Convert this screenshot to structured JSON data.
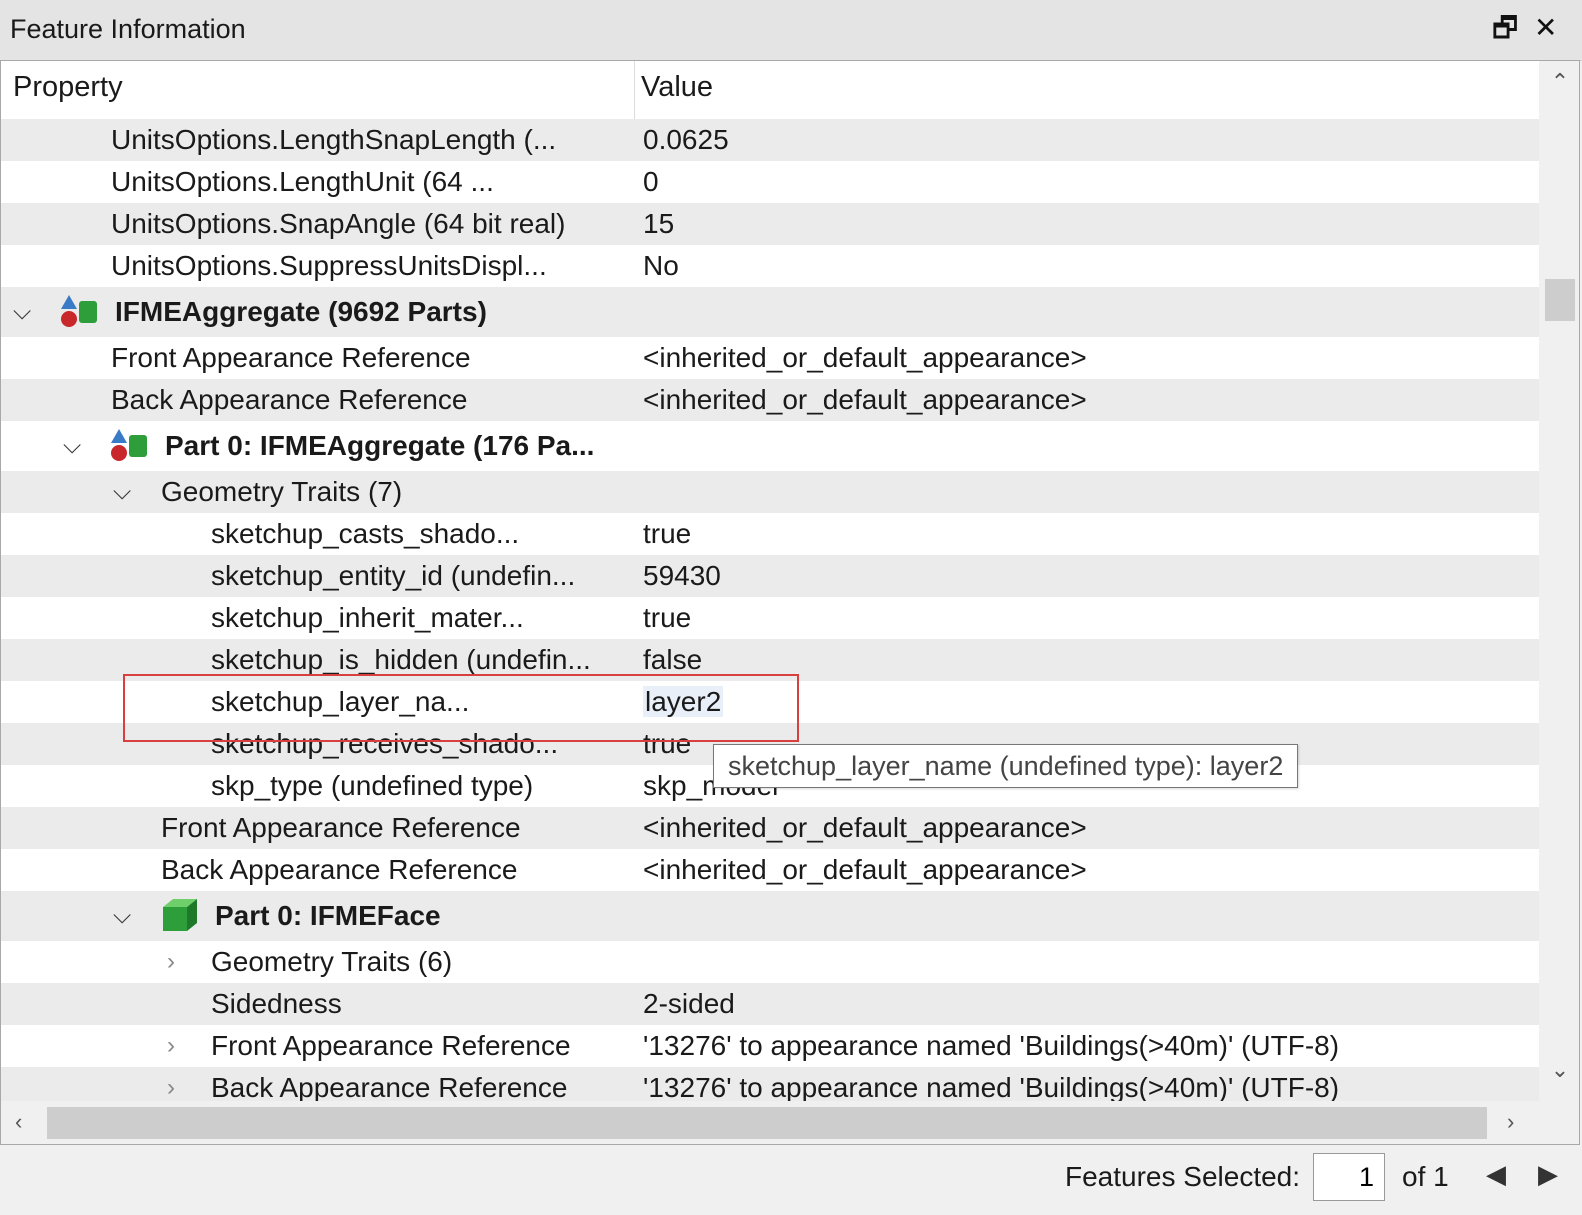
{
  "window": {
    "title": "Feature Information",
    "restore_icon": "restore-window-icon",
    "close_icon": "close-icon"
  },
  "table": {
    "columns": {
      "property": "Property",
      "value": "Value"
    },
    "rows": [
      {
        "prop": "UnitsOptions.LengthSnapLength (...",
        "val": "0.0625"
      },
      {
        "prop": "UnitsOptions.LengthUnit (64 ...",
        "val": "0"
      },
      {
        "prop": "UnitsOptions.SnapAngle (64 bit real)",
        "val": "15"
      },
      {
        "prop": "UnitsOptions.SuppressUnitsDispl...",
        "val": "No"
      },
      {
        "prop": "IFMEAggregate (9692 Parts)",
        "val": ""
      },
      {
        "prop": "Front Appearance Reference",
        "val": "<inherited_or_default_appearance>"
      },
      {
        "prop": "Back Appearance Reference",
        "val": "<inherited_or_default_appearance>"
      },
      {
        "prop": "Part 0: IFMEAggregate (176 Pa...",
        "val": ""
      },
      {
        "prop": "Geometry Traits (7)",
        "val": ""
      },
      {
        "prop": "sketchup_casts_shado...",
        "val": "true"
      },
      {
        "prop": "sketchup_entity_id (undefin...",
        "val": "59430"
      },
      {
        "prop": "sketchup_inherit_mater...",
        "val": "true"
      },
      {
        "prop": "sketchup_is_hidden (undefin...",
        "val": "false"
      },
      {
        "prop": "sketchup_layer_na...",
        "val": "layer2"
      },
      {
        "prop": "sketchup_receives_shado...",
        "val": "true"
      },
      {
        "prop": "skp_type (undefined type)",
        "val": "skp_model"
      },
      {
        "prop": "Front Appearance Reference",
        "val": "<inherited_or_default_appearance>"
      },
      {
        "prop": "Back Appearance Reference",
        "val": "<inherited_or_default_appearance>"
      },
      {
        "prop": "Part 0: IFMEFace",
        "val": ""
      },
      {
        "prop": "Geometry Traits (6)",
        "val": ""
      },
      {
        "prop": "Sidedness",
        "val": "2-sided"
      },
      {
        "prop": "Front Appearance Reference",
        "val": "'13276' to appearance named 'Buildings(>40m)' (UTF-8)"
      },
      {
        "prop": "Back Appearance Reference",
        "val": "'13276' to appearance named 'Buildings(>40m)' (UTF-8)"
      }
    ]
  },
  "tooltip": {
    "text": "sketchup_layer_name (undefined type): layer2"
  },
  "footer": {
    "features_selected_label": "Features Selected:",
    "current": "1",
    "of_total": "of 1"
  },
  "colors": {
    "highlight_border": "#d84040",
    "aggregate_icon_green": "#2e9e3a",
    "aggregate_icon_red": "#c8282a"
  }
}
